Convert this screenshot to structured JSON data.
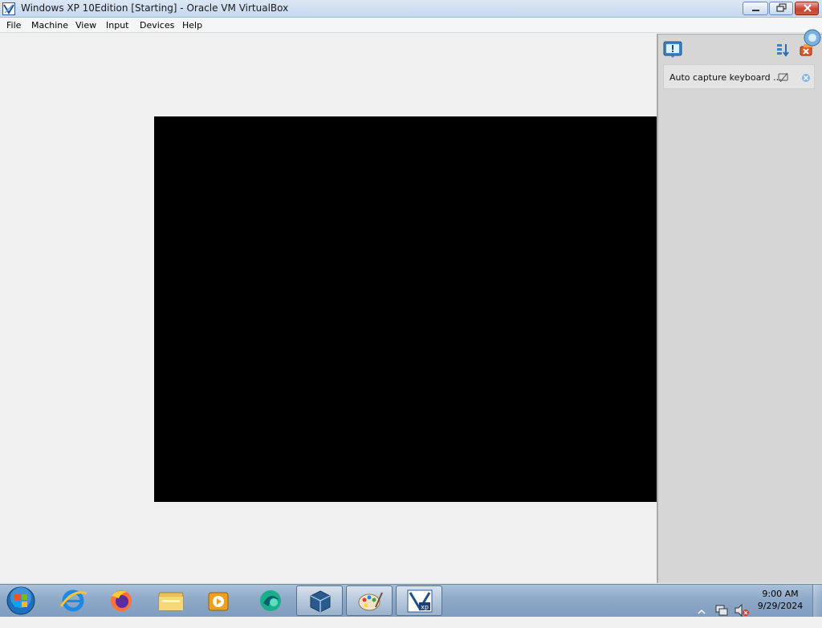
{
  "window": {
    "title": "Windows XP 10Edition [Starting] - Oracle VM VirtualBox",
    "app_icon": "virtualbox-icon",
    "controls": [
      "minimize-icon",
      "maximize-icon",
      "close-icon"
    ]
  },
  "menubar": {
    "items": [
      "File",
      "Machine",
      "View",
      "Input",
      "Devices",
      "Help"
    ]
  },
  "side_panel": {
    "header_icons": [
      "notification-icon",
      "sort-icon",
      "close-all-icon",
      "network-icon"
    ],
    "notification": {
      "message": "Auto capture keyboard ...",
      "icons": [
        "do-not-show-icon",
        "close-icon"
      ]
    }
  },
  "taskbar": {
    "start_icon": "windows-start-orb-icon",
    "buttons": [
      {
        "icon": "internet-explorer-icon",
        "active": false
      },
      {
        "icon": "firefox-icon",
        "active": false
      },
      {
        "icon": "file-explorer-icon",
        "active": false
      },
      {
        "icon": "media-player-icon",
        "active": false
      },
      {
        "icon": "browser-icon",
        "active": false
      },
      {
        "icon": "virtualbox-icon",
        "active": true
      },
      {
        "icon": "paint-icon",
        "active": true
      },
      {
        "icon": "windows-xp-vm-icon",
        "active": true
      }
    ],
    "tray_icons": [
      "show-hidden-icons-icon",
      "network-icon",
      "volume-muted-icon"
    ],
    "clock": {
      "time": "9:00 AM",
      "date": "9/29/2024"
    }
  },
  "colors": {
    "vm_screen": "#000000",
    "titlebar": "#c7d9ee",
    "taskbar": "#8ea9c8",
    "close_button": "#c7452f"
  }
}
